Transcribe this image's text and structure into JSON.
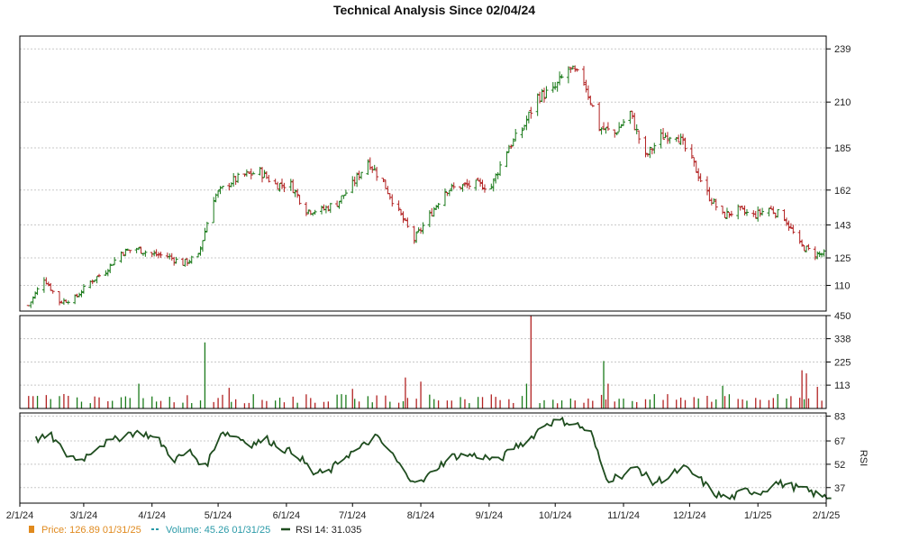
{
  "chart_data": {
    "type": "financial",
    "title": "Technical Analysis Since 02/04/24",
    "colors": {
      "up": "#1a7a1a",
      "down": "#b22222",
      "rsi": "#1f4d1f",
      "price_legend": "#e08a1e",
      "volume_legend": "#2a9aa8"
    },
    "x_tick_labels": [
      "2/1/24",
      "3/1/24",
      "4/1/24",
      "5/1/24",
      "6/1/24",
      "7/1/24",
      "8/1/24",
      "9/1/24",
      "10/1/24",
      "11/1/24",
      "12/1/24",
      "1/1/25",
      "2/1/25"
    ],
    "price_panel": {
      "y_ticks": [
        110,
        125,
        143,
        162,
        185,
        210,
        239
      ],
      "ylim": [
        96,
        246
      ],
      "weekly_close": [
        [
          "2024-02-05",
          99
        ],
        [
          "2024-02-12",
          114
        ],
        [
          "2024-02-19",
          101
        ],
        [
          "2024-02-26",
          103
        ],
        [
          "2024-03-04",
          112
        ],
        [
          "2024-03-11",
          118
        ],
        [
          "2024-03-18",
          128
        ],
        [
          "2024-03-25",
          130
        ],
        [
          "2024-04-01",
          127
        ],
        [
          "2024-04-08",
          126
        ],
        [
          "2024-04-15",
          122
        ],
        [
          "2024-04-22",
          126
        ],
        [
          "2024-04-29",
          158
        ],
        [
          "2024-05-06",
          166
        ],
        [
          "2024-05-13",
          170
        ],
        [
          "2024-05-20",
          172
        ],
        [
          "2024-05-27",
          165
        ],
        [
          "2024-06-03",
          165
        ],
        [
          "2024-06-10",
          151
        ],
        [
          "2024-06-17",
          151
        ],
        [
          "2024-06-24",
          155
        ],
        [
          "2024-07-01",
          165
        ],
        [
          "2024-07-08",
          178
        ],
        [
          "2024-07-15",
          166
        ],
        [
          "2024-07-22",
          150
        ],
        [
          "2024-07-29",
          135
        ],
        [
          "2024-08-05",
          148
        ],
        [
          "2024-08-12",
          162
        ],
        [
          "2024-08-19",
          164
        ],
        [
          "2024-08-26",
          165
        ],
        [
          "2024-09-02",
          164
        ],
        [
          "2024-09-09",
          184
        ],
        [
          "2024-09-16",
          195
        ],
        [
          "2024-09-23",
          213
        ],
        [
          "2024-09-30",
          216
        ],
        [
          "2024-10-07",
          228
        ],
        [
          "2024-10-14",
          222
        ],
        [
          "2024-10-21",
          196
        ],
        [
          "2024-10-28",
          193
        ],
        [
          "2024-11-04",
          204
        ],
        [
          "2024-11-11",
          180
        ],
        [
          "2024-11-18",
          191
        ],
        [
          "2024-11-25",
          193
        ],
        [
          "2024-12-02",
          178
        ],
        [
          "2024-12-09",
          160
        ],
        [
          "2024-12-16",
          148
        ],
        [
          "2024-12-23",
          151
        ],
        [
          "2024-12-30",
          148
        ],
        [
          "2025-01-06",
          152
        ],
        [
          "2025-01-13",
          147
        ],
        [
          "2025-01-20",
          132
        ],
        [
          "2025-01-27",
          127
        ]
      ]
    },
    "volume_panel": {
      "y_ticks": [
        113,
        225,
        338,
        450
      ],
      "ylim": [
        0,
        450
      ],
      "spikes": [
        [
          "2024-02-21",
          70
        ],
        [
          "2024-03-26",
          120
        ],
        [
          "2024-04-25",
          320
        ],
        [
          "2024-05-06",
          100
        ],
        [
          "2024-07-01",
          95
        ],
        [
          "2024-07-25",
          150
        ],
        [
          "2024-08-01",
          130
        ],
        [
          "2024-09-18",
          120
        ],
        [
          "2024-09-20",
          450
        ],
        [
          "2024-10-23",
          230
        ],
        [
          "2024-10-25",
          120
        ],
        [
          "2024-12-16",
          110
        ],
        [
          "2025-01-21",
          185
        ],
        [
          "2025-01-23",
          170
        ],
        [
          "2025-01-28",
          105
        ]
      ]
    },
    "rsi_panel": {
      "y_ticks": [
        37,
        52,
        67,
        83
      ],
      "ylim": [
        27,
        85
      ],
      "axis_label": "RSI",
      "weekly": [
        [
          "2024-02-05",
          68
        ],
        [
          "2024-02-12",
          70
        ],
        [
          "2024-02-19",
          58
        ],
        [
          "2024-02-26",
          55
        ],
        [
          "2024-03-04",
          64
        ],
        [
          "2024-03-11",
          67
        ],
        [
          "2024-03-18",
          72
        ],
        [
          "2024-03-25",
          72
        ],
        [
          "2024-04-01",
          67
        ],
        [
          "2024-04-08",
          55
        ],
        [
          "2024-04-15",
          60
        ],
        [
          "2024-04-22",
          50
        ],
        [
          "2024-04-29",
          73
        ],
        [
          "2024-05-06",
          70
        ],
        [
          "2024-05-13",
          65
        ],
        [
          "2024-05-20",
          68
        ],
        [
          "2024-05-27",
          62
        ],
        [
          "2024-06-03",
          58
        ],
        [
          "2024-06-10",
          46
        ],
        [
          "2024-06-17",
          47
        ],
        [
          "2024-06-24",
          57
        ],
        [
          "2024-07-01",
          62
        ],
        [
          "2024-07-08",
          70
        ],
        [
          "2024-07-15",
          60
        ],
        [
          "2024-07-22",
          45
        ],
        [
          "2024-07-29",
          40
        ],
        [
          "2024-08-05",
          50
        ],
        [
          "2024-08-12",
          57
        ],
        [
          "2024-08-19",
          58
        ],
        [
          "2024-08-26",
          57
        ],
        [
          "2024-09-02",
          54
        ],
        [
          "2024-09-09",
          63
        ],
        [
          "2024-09-16",
          68
        ],
        [
          "2024-09-23",
          78
        ],
        [
          "2024-09-30",
          80
        ],
        [
          "2024-10-07",
          78
        ],
        [
          "2024-10-14",
          72
        ],
        [
          "2024-10-21",
          42
        ],
        [
          "2024-10-28",
          45
        ],
        [
          "2024-11-04",
          50
        ],
        [
          "2024-11-11",
          40
        ],
        [
          "2024-11-18",
          44
        ],
        [
          "2024-11-25",
          50
        ],
        [
          "2024-12-02",
          43
        ],
        [
          "2024-12-09",
          33
        ],
        [
          "2024-12-16",
          30
        ],
        [
          "2024-12-23",
          35
        ],
        [
          "2024-12-30",
          34
        ],
        [
          "2025-01-06",
          40
        ],
        [
          "2025-01-13",
          38
        ],
        [
          "2025-01-20",
          35
        ],
        [
          "2025-01-27",
          31
        ]
      ]
    },
    "legend": [
      {
        "key": "price",
        "label": "Price: 126.89  01/31/25"
      },
      {
        "key": "volume",
        "label": "Volume: 45.26  01/31/25"
      },
      {
        "key": "rsi",
        "label": "RSI 14: 31.035"
      }
    ]
  }
}
